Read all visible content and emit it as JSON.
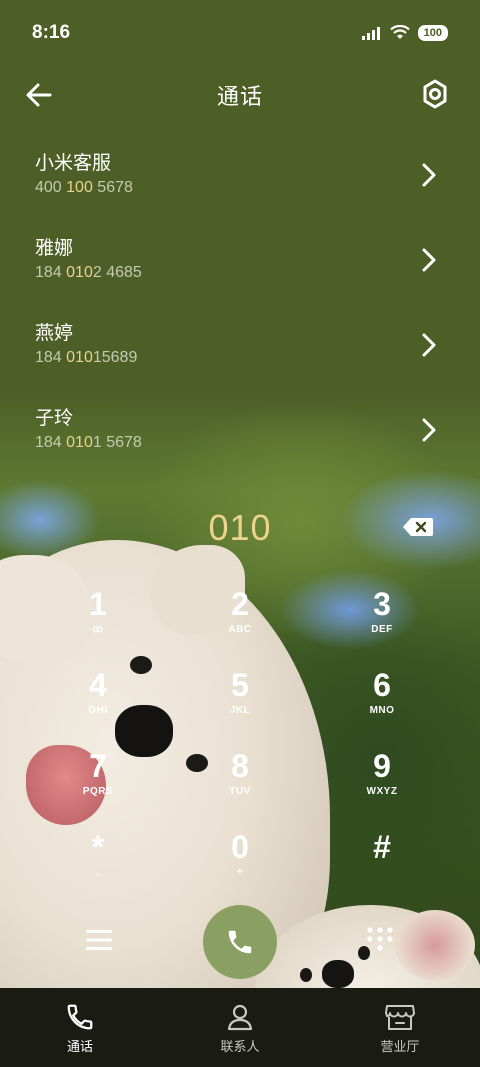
{
  "status_bar": {
    "time": "8:16",
    "battery": "100"
  },
  "header": {
    "title": "通话"
  },
  "contacts": [
    {
      "name": "小米客服",
      "number_pre": "400 ",
      "number_hl": "100",
      "number_post": " 5678"
    },
    {
      "name": "雅娜",
      "number_pre": "184 ",
      "number_hl": "010",
      "number_post": "2 4685"
    },
    {
      "name": "燕婷",
      "number_pre": "184 ",
      "number_hl": "010",
      "number_post": "15689"
    },
    {
      "name": "子玲",
      "number_pre": "184 ",
      "number_hl": "010",
      "number_post": "1 5678"
    }
  ],
  "dialer": {
    "digits": "010"
  },
  "keypad": [
    [
      {
        "digit": "1",
        "letters": "ꝏ"
      },
      {
        "digit": "2",
        "letters": "ABC"
      },
      {
        "digit": "3",
        "letters": "DEF"
      }
    ],
    [
      {
        "digit": "4",
        "letters": "GHI"
      },
      {
        "digit": "5",
        "letters": "JKL"
      },
      {
        "digit": "6",
        "letters": "MNO"
      }
    ],
    [
      {
        "digit": "7",
        "letters": "PQRS"
      },
      {
        "digit": "8",
        "letters": "TUV"
      },
      {
        "digit": "9",
        "letters": "WXYZ"
      }
    ],
    [
      {
        "digit": "*",
        "letters": ","
      },
      {
        "digit": "0",
        "letters": "+"
      },
      {
        "digit": "#",
        "letters": ""
      }
    ]
  ],
  "tabs": [
    {
      "label": "通话",
      "icon": "phone-icon",
      "active": true
    },
    {
      "label": "联系人",
      "icon": "person-icon",
      "active": false
    },
    {
      "label": "营业厅",
      "icon": "store-icon",
      "active": false
    }
  ],
  "colors": {
    "header_bg": "#4d5e27",
    "call_button": "#8aa063",
    "highlight": "#e9d48a",
    "tab_bar": "#1a1c14"
  }
}
